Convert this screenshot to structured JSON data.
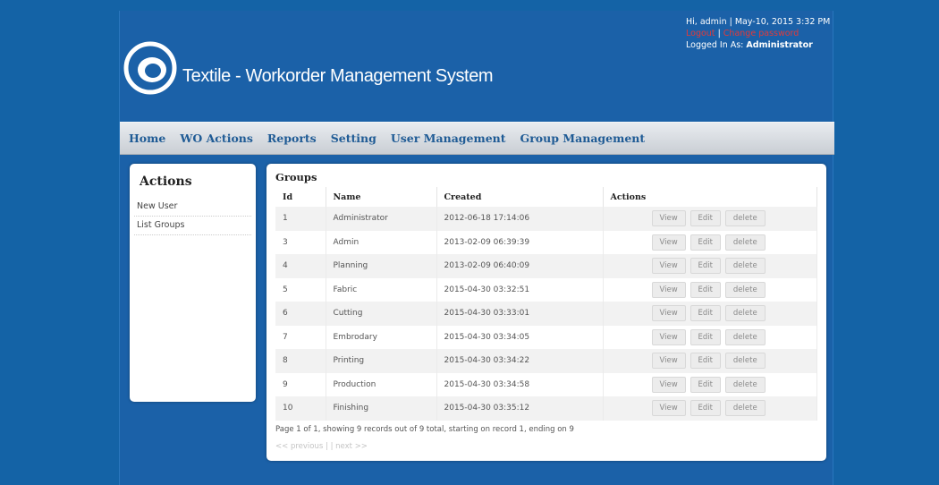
{
  "header": {
    "app_title": "Textile - Workorder Management System",
    "greeting": "Hi, admin | May-10, 2015 3:32 PM",
    "logout_label": "Logout",
    "change_password_label": "Change password",
    "link_separator": "|",
    "logged_in_prefix": "Logged In As:",
    "logged_in_role": "Administrator"
  },
  "nav": {
    "items": [
      "Home",
      "WO Actions",
      "Reports",
      "Setting",
      "User Management",
      "Group Management"
    ]
  },
  "sidebar": {
    "title": "Actions",
    "links": [
      "New User",
      "List Groups"
    ]
  },
  "groups": {
    "title": "Groups",
    "columns": [
      "Id",
      "Name",
      "Created",
      "Actions"
    ],
    "rows": [
      {
        "id": "1",
        "name": "Administrator",
        "created": "2012-06-18 17:14:06"
      },
      {
        "id": "3",
        "name": "Admin",
        "created": "2013-02-09 06:39:39"
      },
      {
        "id": "4",
        "name": "Planning",
        "created": "2013-02-09 06:40:09"
      },
      {
        "id": "5",
        "name": "Fabric",
        "created": "2015-04-30 03:32:51"
      },
      {
        "id": "6",
        "name": "Cutting",
        "created": "2015-04-30 03:33:01"
      },
      {
        "id": "7",
        "name": "Embrodary",
        "created": "2015-04-30 03:34:05"
      },
      {
        "id": "8",
        "name": "Printing",
        "created": "2015-04-30 03:34:22"
      },
      {
        "id": "9",
        "name": "Production",
        "created": "2015-04-30 03:34:58"
      },
      {
        "id": "10",
        "name": "Finishing",
        "created": "2015-04-30 03:35:12"
      }
    ],
    "row_actions": {
      "view": "View",
      "edit": "Edit",
      "delete": "delete"
    },
    "paging_text": "Page 1 of 1, showing 9 records out of 9 total, starting on record 1, ending on 9",
    "pager": {
      "previous": "<< previous",
      "separator": "|",
      "next": "next >>"
    }
  },
  "colors": {
    "background": "#1463a6",
    "nav_text": "#1f5b95",
    "logout_link": "#e23a3a"
  }
}
